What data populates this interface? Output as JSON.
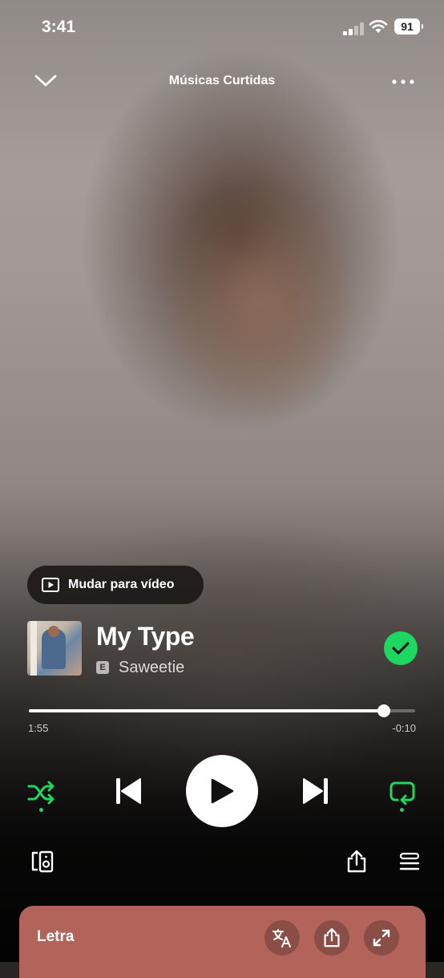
{
  "status_bar": {
    "time": "3:41",
    "battery": "91"
  },
  "header": {
    "title": "Músicas Curtidas",
    "collapse_icon": "chevron-down-icon",
    "more_icon": "more-horizontal-icon"
  },
  "video_switch": {
    "label": "Mudar para vídeo",
    "icon": "video-icon"
  },
  "track": {
    "title": "My Type",
    "artist": "Saweetie",
    "explicit_badge": "E",
    "liked": true
  },
  "progress": {
    "elapsed": "1:55",
    "remaining": "-0:10",
    "fraction": 0.9199999999999999
  },
  "controls": {
    "shuffle_active": true,
    "repeat_active": true,
    "state": "paused"
  },
  "lyrics": {
    "title": "Letra",
    "icons": [
      "translate-icon",
      "share-icon",
      "expand-icon"
    ]
  },
  "colors": {
    "accent": "#1ed760",
    "lyrics_card": "#b3645a"
  }
}
